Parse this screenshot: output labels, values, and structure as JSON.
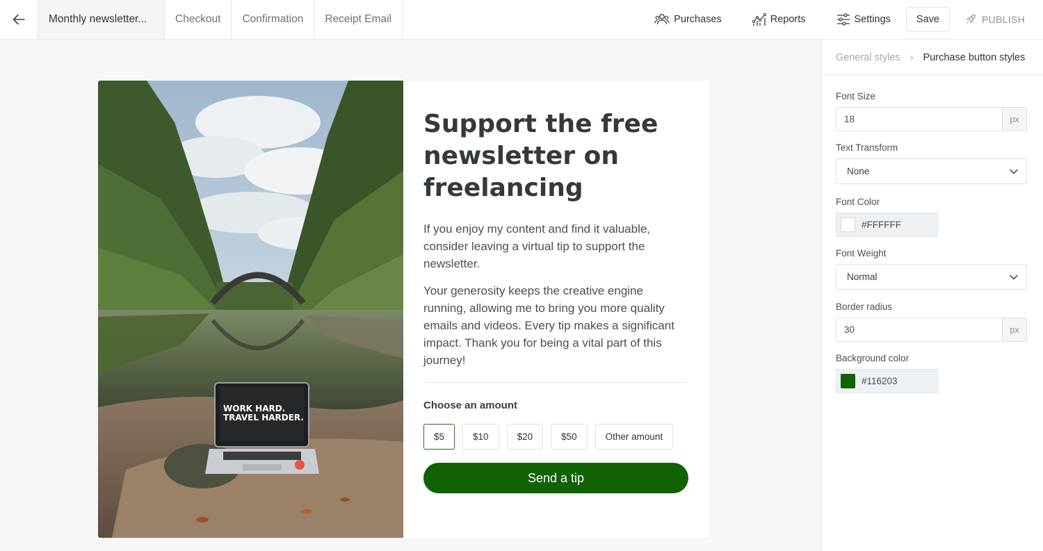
{
  "header": {
    "tabs": [
      {
        "label": "Monthly newsletter..."
      },
      {
        "label": "Checkout"
      },
      {
        "label": "Confirmation"
      },
      {
        "label": "Receipt Email"
      }
    ],
    "nav": {
      "purchases": "Purchases",
      "reports": "Reports",
      "settings": "Settings",
      "save": "Save",
      "publish": "PUBLISH"
    }
  },
  "page": {
    "headline": "Support the free newsletter on freelancing",
    "paragraph_1": "If you enjoy my content and find it valuable, consider leaving a virtual tip to support the newsletter.",
    "paragraph_2": "Your generosity keeps the creative engine running, allowing me to bring you more quality emails and videos. Every tip makes a significant impact. Thank you for being a vital part of this journey!",
    "photo_caption": "WORK HARD. TRAVEL HARDER.",
    "choose_label": "Choose an amount",
    "amounts": [
      "$5",
      "$10",
      "$20",
      "$50",
      "Other amount"
    ],
    "selected_amount": "$5",
    "cta": "Send a tip"
  },
  "panel": {
    "breadcrumb": [
      "General styles",
      "Purchase button styles"
    ],
    "font_size": {
      "label": "Font Size",
      "value": "18",
      "unit": "px"
    },
    "text_transform": {
      "label": "Text Transform",
      "value": "None"
    },
    "font_color": {
      "label": "Font Color",
      "value": "#FFFFFF"
    },
    "font_weight": {
      "label": "Font Weight",
      "value": "Normal"
    },
    "border_radius": {
      "label": "Border radius",
      "value": "30",
      "unit": "px"
    },
    "background_color": {
      "label": "Background color",
      "value": "#116203"
    }
  },
  "colors": {
    "button_bg": "#116203",
    "button_text": "#FFFFFF"
  },
  "icons": {
    "back": "arrow-left-icon",
    "purchases": "users-icon",
    "reports": "chart-icon",
    "settings": "sliders-icon",
    "publish": "rocket-icon",
    "dropdown": "chevron-down-icon"
  }
}
